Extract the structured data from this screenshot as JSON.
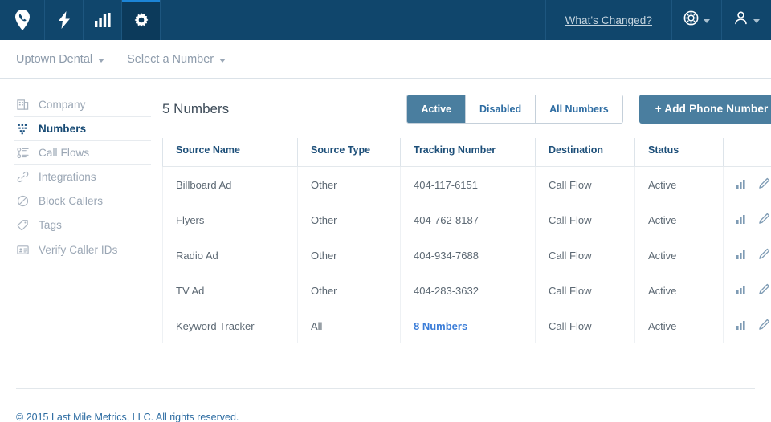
{
  "topnav": {
    "background": "#10466c",
    "active_accent": "#1c84d6",
    "tabs": [
      {
        "name": "logo",
        "icon": "map-pin-phone-icon",
        "active": false
      },
      {
        "name": "activity",
        "icon": "lightning-bolt-icon",
        "active": false
      },
      {
        "name": "reports",
        "icon": "bar-chart-icon",
        "active": false
      },
      {
        "name": "settings",
        "icon": "gear-icon",
        "active": true
      }
    ],
    "whats_changed": "What's Changed?",
    "support_icon": "life-ring-icon",
    "account_icon": "person-icon"
  },
  "breadcrumb": {
    "account": "Uptown Dental",
    "number_selector": "Select a Number"
  },
  "sidebar": {
    "items": [
      {
        "label": "Company",
        "icon": "building-icon",
        "active": false
      },
      {
        "label": "Numbers",
        "icon": "keypad-icon",
        "active": true
      },
      {
        "label": "Call Flows",
        "icon": "flow-list-icon",
        "active": false
      },
      {
        "label": "Integrations",
        "icon": "link-icon",
        "active": false
      },
      {
        "label": "Block Callers",
        "icon": "ban-icon",
        "active": false
      },
      {
        "label": "Tags",
        "icon": "tag-icon",
        "active": false
      },
      {
        "label": "Verify Caller IDs",
        "icon": "id-card-icon",
        "active": false
      }
    ]
  },
  "main": {
    "title": "5 Numbers",
    "filters": [
      {
        "label": "Active",
        "active": true
      },
      {
        "label": "Disabled",
        "active": false
      },
      {
        "label": "All Numbers",
        "active": false
      }
    ],
    "add_button": "+  Add Phone Number",
    "table": {
      "columns": [
        "Source Name",
        "Source Type",
        "Tracking Number",
        "Destination",
        "Status",
        ""
      ],
      "rows": [
        {
          "source_name": "Billboard Ad",
          "source_type": "Other",
          "tracking_number": "404-117-6151",
          "tracking_is_link": false,
          "destination": "Call Flow",
          "status": "Active"
        },
        {
          "source_name": "Flyers",
          "source_type": "Other",
          "tracking_number": "404-762-8187",
          "tracking_is_link": false,
          "destination": "Call Flow",
          "status": "Active"
        },
        {
          "source_name": "Radio Ad",
          "source_type": "Other",
          "tracking_number": "404-934-7688",
          "tracking_is_link": false,
          "destination": "Call Flow",
          "status": "Active"
        },
        {
          "source_name": "TV Ad",
          "source_type": "Other",
          "tracking_number": "404-283-3632",
          "tracking_is_link": false,
          "destination": "Call Flow",
          "status": "Active"
        },
        {
          "source_name": "Keyword Tracker",
          "source_type": "All",
          "tracking_number": "8 Numbers",
          "tracking_is_link": true,
          "destination": "Call Flow",
          "status": "Active"
        }
      ],
      "row_actions": [
        "bar-chart-icon",
        "pencil-edit-icon"
      ]
    }
  },
  "footer": {
    "copyright": "© 2015 Last Mile Metrics, LLC. All rights reserved."
  },
  "colors": {
    "nav_bg": "#10466c",
    "accent_blue": "#1c84d6",
    "link_blue": "#3b7dd8",
    "button_blue": "#4a7e9f",
    "header_text": "#1d4f79"
  }
}
